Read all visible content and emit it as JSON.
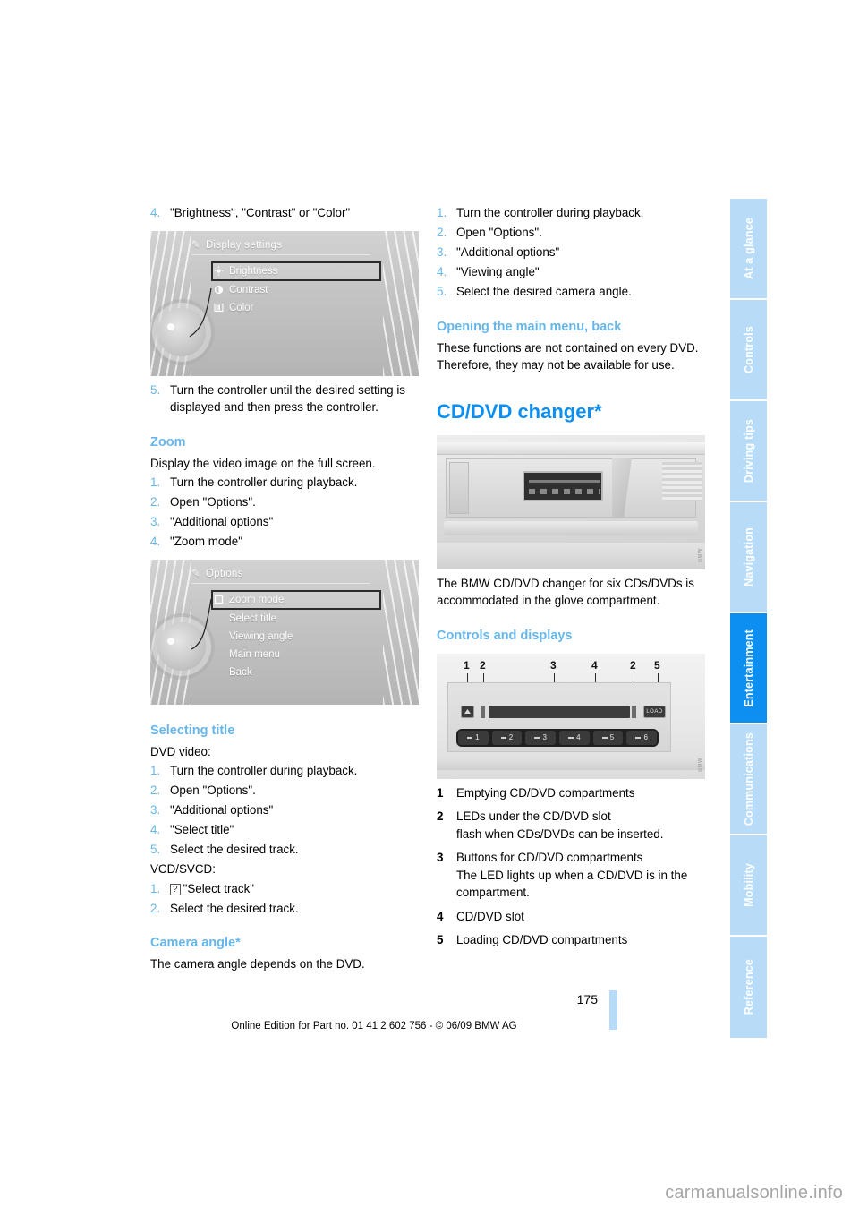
{
  "page": {
    "number": "175",
    "footer_text": "Online Edition for Part no. 01 41 2 602 756 - © 06/09 BMW AG",
    "watermark": "carmanualsonline.info"
  },
  "sidebar": {
    "tabs": [
      {
        "label": "At a glance",
        "active": false
      },
      {
        "label": "Controls",
        "active": false
      },
      {
        "label": "Driving tips",
        "active": false
      },
      {
        "label": "Navigation",
        "active": false
      },
      {
        "label": "Entertainment",
        "active": true
      },
      {
        "label": "Communications",
        "active": false
      },
      {
        "label": "Mobility",
        "active": false
      },
      {
        "label": "Reference",
        "active": false
      }
    ],
    "active_color": "#0c8ff0",
    "inactive_color": "#b8dcf7"
  },
  "left_column": {
    "step4_top": {
      "num": "4.",
      "text": "\"Brightness\", \"Contrast\" or \"Color\""
    },
    "figure_display_settings": {
      "title": "Display settings",
      "items": [
        {
          "label": "Brightness",
          "selected": true,
          "icon": "brightness-icon"
        },
        {
          "label": "Contrast",
          "selected": false,
          "icon": "contrast-icon"
        },
        {
          "label": "Color",
          "selected": false,
          "icon": "color-icon"
        }
      ],
      "code": ""
    },
    "step5_top": {
      "num": "5.",
      "text": "Turn the controller until the desired setting is displayed and then press the controller."
    },
    "zoom_heading": "Zoom",
    "zoom_intro": "Display the video image on the full screen.",
    "zoom_steps": [
      {
        "num": "1.",
        "text": "Turn the controller during playback."
      },
      {
        "num": "2.",
        "text": "Open \"Options\"."
      },
      {
        "num": "3.",
        "text": "\"Additional options\""
      },
      {
        "num": "4.",
        "text": "\"Zoom mode\""
      }
    ],
    "figure_options": {
      "title": "Options",
      "items": [
        {
          "label": "Zoom mode",
          "selected": true,
          "icon": "checkbox-icon"
        },
        {
          "label": "Select title",
          "selected": false,
          "icon": ""
        },
        {
          "label": "Viewing angle",
          "selected": false,
          "icon": ""
        },
        {
          "label": "Main menu",
          "selected": false,
          "icon": ""
        },
        {
          "label": "Back",
          "selected": false,
          "icon": ""
        }
      ]
    },
    "selecting_title_heading": "Selecting title",
    "dvd_video_label": "DVD video:",
    "dvd_video_steps": [
      {
        "num": "1.",
        "text": "Turn the controller during playback."
      },
      {
        "num": "2.",
        "text": "Open \"Options\"."
      },
      {
        "num": "3.",
        "text": "\"Additional options\""
      },
      {
        "num": "4.",
        "text": "\"Select title\""
      },
      {
        "num": "5.",
        "text": "Select the desired track."
      }
    ],
    "vcd_label": "VCD/SVCD:",
    "vcd_steps": [
      {
        "num": "1.",
        "glyph": "?",
        "text": "\"Select track\""
      },
      {
        "num": "2.",
        "glyph": "",
        "text": "Select the desired track."
      }
    ],
    "camera_angle_heading": "Camera angle*",
    "camera_angle_text": "The camera angle depends on the DVD."
  },
  "right_column": {
    "camera_steps": [
      {
        "num": "1.",
        "text": "Turn the controller during playback."
      },
      {
        "num": "2.",
        "text": "Open \"Options\"."
      },
      {
        "num": "3.",
        "text": "\"Additional options\""
      },
      {
        "num": "4.",
        "text": "\"Viewing angle\""
      },
      {
        "num": "5.",
        "text": "Select the desired camera angle."
      }
    ],
    "main_menu_heading": "Opening the main menu, back",
    "main_menu_text": "These functions are not contained on every DVD. Therefore, they may not be available for use.",
    "changer_heading": "CD/DVD changer*",
    "changer_caption": "The BMW CD/DVD changer for six CDs/DVDs is accommodated in the glove compartment.",
    "controls_heading": "Controls and displays",
    "diagram_callouts": [
      "1",
      "2",
      "3",
      "4",
      "2",
      "5"
    ],
    "diagram_buttons": [
      "1",
      "2",
      "3",
      "4",
      "5",
      "6"
    ],
    "diagram_load_label": "LOAD",
    "legend": [
      {
        "num": "1",
        "lines": [
          "Emptying CD/DVD compartments"
        ]
      },
      {
        "num": "2",
        "lines": [
          "LEDs under the CD/DVD slot",
          "flash when CDs/DVDs can be inserted."
        ]
      },
      {
        "num": "3",
        "lines": [
          "Buttons for CD/DVD compartments",
          "The LED lights up when a CD/DVD is in the compartment."
        ]
      },
      {
        "num": "4",
        "lines": [
          "CD/DVD slot"
        ]
      },
      {
        "num": "5",
        "lines": [
          "Loading CD/DVD compartments"
        ]
      }
    ]
  }
}
